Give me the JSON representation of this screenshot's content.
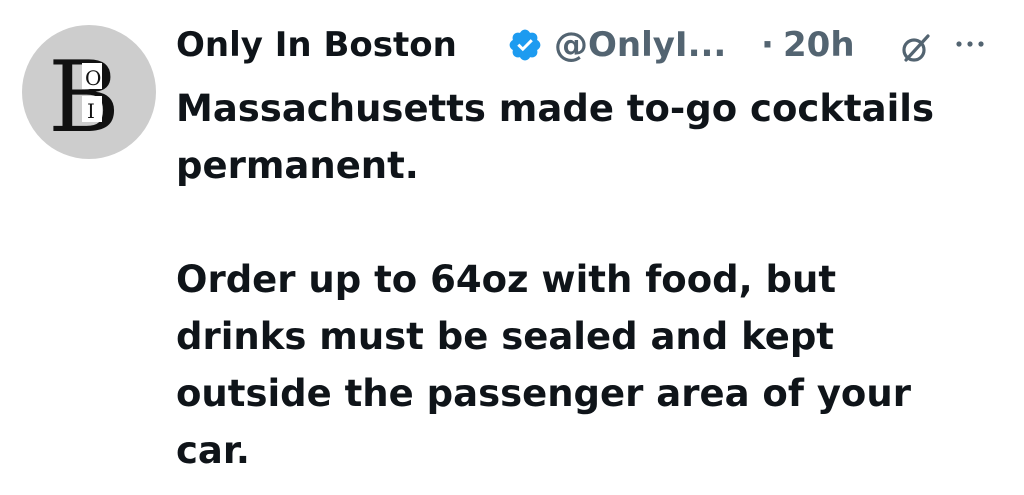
{
  "tweet": {
    "author": {
      "display_name": "Only In Boston",
      "handle": "@OnlyI...",
      "avatar_letters": "BOI",
      "verified": true,
      "verified_color": "#1d9bf0"
    },
    "separator": "·",
    "timestamp": "20h",
    "icons": {
      "grok": "grok-icon",
      "more": "more-options-icon",
      "verified": "verified-badge-icon"
    },
    "text": {
      "paragraph_1": "Massachusetts made to-go cocktails\npermanent.",
      "paragraph_2": "Order up to 64oz with food, but\ndrinks must be sealed and kept\noutside the passenger area of your\ncar."
    }
  }
}
